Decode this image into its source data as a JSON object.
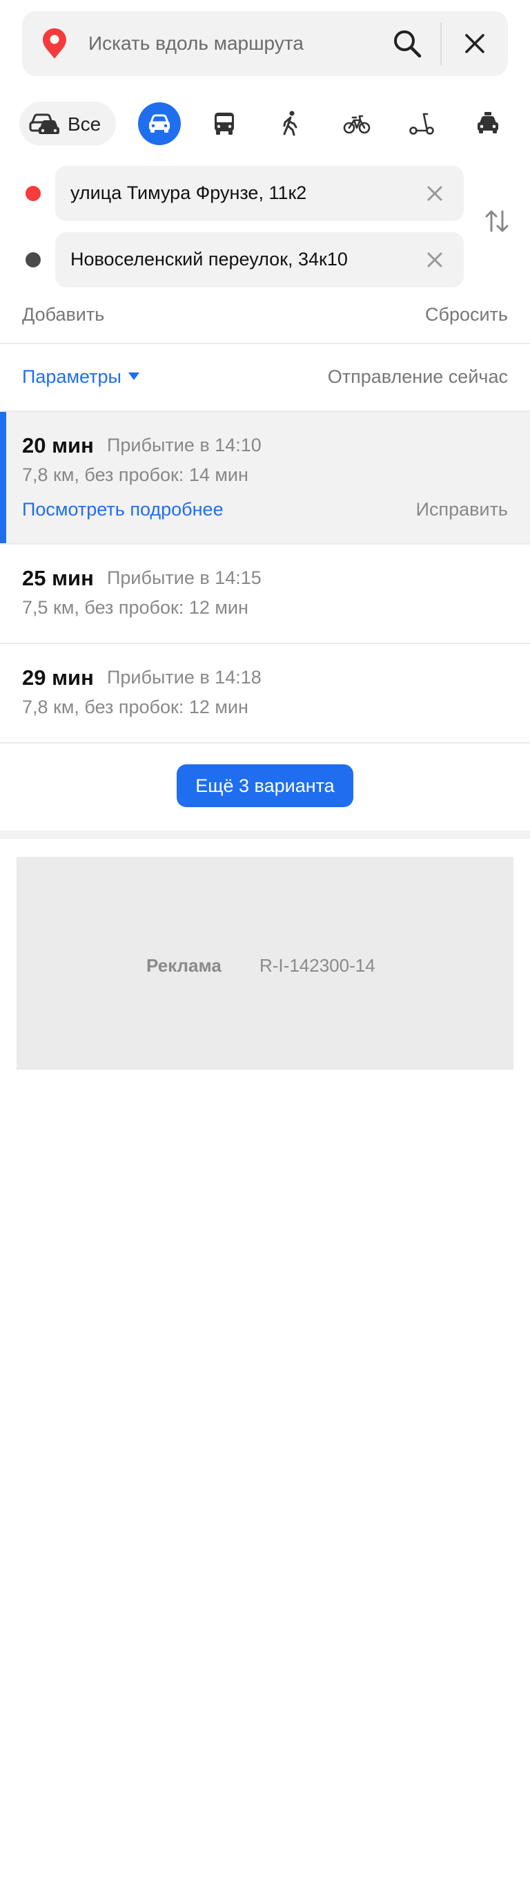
{
  "search": {
    "placeholder": "Искать вдоль маршрута"
  },
  "transport": {
    "all_label": "Все",
    "modes": [
      "car-icon",
      "bus-icon",
      "pedestrian-icon",
      "bicycle-icon",
      "scooter-icon",
      "taxi-icon"
    ],
    "active_mode": "car"
  },
  "points": {
    "from": "улица Тимура Фрунзе, 11к2",
    "to": "Новоселенский переулок, 34к10"
  },
  "actions": {
    "add": "Добавить",
    "reset": "Сбросить"
  },
  "params": {
    "label": "Параметры",
    "departure": "Отправление сейчас"
  },
  "routes": [
    {
      "duration": "20 мин",
      "arrival": "Прибытие в 14:10",
      "details": "7,8 км, без пробок: 14 мин",
      "more": "Посмотреть подробнее",
      "fix": "Исправить"
    },
    {
      "duration": "25 мин",
      "arrival": "Прибытие в 14:15",
      "details": "7,5 км, без пробок: 12 мин"
    },
    {
      "duration": "29 мин",
      "arrival": "Прибытие в 14:18",
      "details": "7,8 км, без пробок: 12 мин"
    }
  ],
  "more_variants": "Ещё 3 варианта",
  "ad": {
    "label": "Реклама",
    "id": "R-I-142300-14"
  },
  "colors": {
    "accent": "#1f6ef0",
    "start_point": "#f63c3c",
    "end_point": "#4a4a4a",
    "panel": "#f2f2f2"
  }
}
